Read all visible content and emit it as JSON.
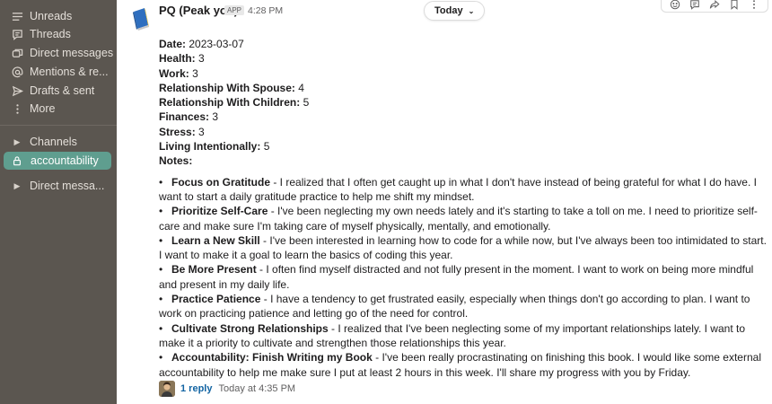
{
  "sidebar": {
    "items": [
      {
        "label": "Unreads",
        "icon": "list-icon"
      },
      {
        "label": "Threads",
        "icon": "threads-icon"
      },
      {
        "label": "Direct messages",
        "icon": "dm-icon"
      },
      {
        "label": "Mentions & re...",
        "icon": "at-icon"
      },
      {
        "label": "Drafts & sent",
        "icon": "send-icon"
      },
      {
        "label": "More",
        "icon": "more-vertical-icon"
      }
    ],
    "channels_label": "Channels",
    "active_channel": "accountability",
    "direct_messages_label": "Direct messa..."
  },
  "message": {
    "sender": "PQ (Peak you)",
    "badge": "APP",
    "time": "4:28 PM",
    "date_divider": "Today",
    "fields": [
      {
        "label": "Date:",
        "value": "2023-03-07"
      },
      {
        "label": "Health:",
        "value": "3"
      },
      {
        "label": "Work:",
        "value": "3"
      },
      {
        "label": "Relationship With Spouse:",
        "value": "4"
      },
      {
        "label": "Relationship With Children:",
        "value": "5"
      },
      {
        "label": "Finances:",
        "value": "3"
      },
      {
        "label": "Stress:",
        "value": "3"
      },
      {
        "label": "Living Intentionally:",
        "value": "5"
      },
      {
        "label": "Notes:",
        "value": ""
      }
    ],
    "notes": [
      {
        "title": "Focus on Gratitude",
        "text": " - I realized that I often get caught up in what I don't have instead of being grateful for what I do have. I want to start a daily gratitude practice to help me shift my mindset."
      },
      {
        "title": "Prioritize Self-Care",
        "text": " - I've been neglecting my own needs lately and it's starting to take a toll on me. I need to prioritize self-care and make sure I'm taking care of myself physically, mentally, and emotionally."
      },
      {
        "title": "Learn a New Skill",
        "text": " - I've been interested in learning how to code for a while now, but I've always been too intimidated to start. I want to make it a goal to learn the basics of coding this year."
      },
      {
        "title": "Be More Present",
        "text": " - I often find myself distracted and not fully present in the moment. I want to work on being more mindful and present in my daily life."
      },
      {
        "title": "Practice Patience",
        "text": " - I have a tendency to get frustrated easily, especially when things don't go according to plan. I want to work on practicing patience and letting go of the need for control."
      },
      {
        "title": "Cultivate Strong Relationships",
        "text": " - I realized that I've been neglecting some of my important relationships lately. I want to make it a priority to cultivate and strengthen those relationships this year."
      },
      {
        "title": "Accountability: Finish Writing my Book",
        "text": " - I've been really procrastinating on finishing this book. I would like some external accountability to help me make sure I put at least 2 hours in this week. I'll share my progress with you by Friday."
      }
    ],
    "reply_count": "1 reply",
    "reply_time": "Today at 4:35 PM"
  },
  "colors": {
    "sidebar_bg": "#5b5650",
    "active_channel_bg": "#5f9e8f",
    "link": "#1264a3"
  }
}
